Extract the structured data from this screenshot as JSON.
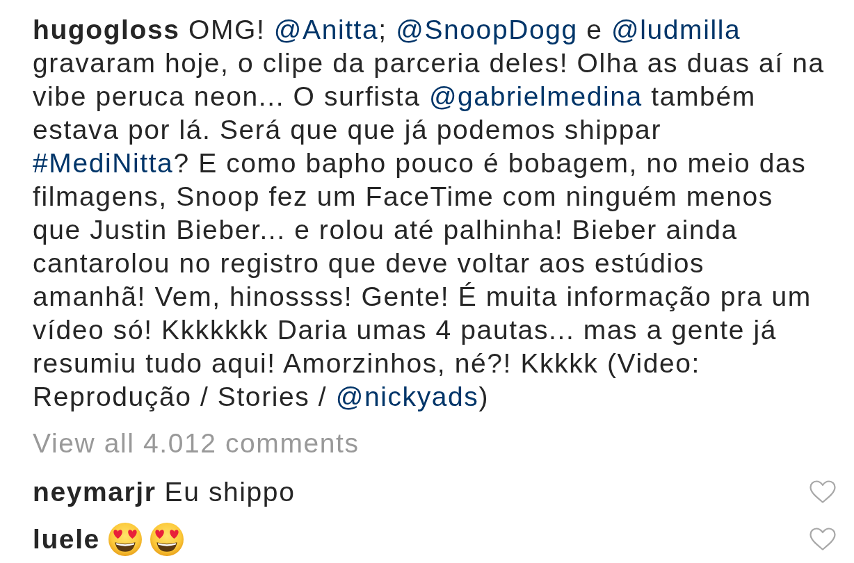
{
  "post": {
    "caption_lines": [
      [
        {
          "kind": "username",
          "text": "hugogloss"
        },
        {
          "kind": "text",
          "text": " OMG! "
        },
        {
          "kind": "mention",
          "text": "@Anitta"
        },
        {
          "kind": "text",
          "text": "; "
        },
        {
          "kind": "mention",
          "text": "@SnoopDogg"
        },
        {
          "kind": "text",
          "text": " e "
        },
        {
          "kind": "mention",
          "text": "@ludmilla"
        }
      ],
      [
        {
          "kind": "text",
          "text": "gravaram hoje, o clipe da parceria deles! Olha as duas aí na"
        }
      ],
      [
        {
          "kind": "text",
          "text": "vibe peruca neon... O surfista "
        },
        {
          "kind": "mention",
          "text": "@gabrielmedina"
        },
        {
          "kind": "text",
          "text": " também"
        }
      ],
      [
        {
          "kind": "text",
          "text": "estava por lá. Será que que já podemos shippar"
        }
      ],
      [
        {
          "kind": "hashtag",
          "text": "#MediNitta"
        },
        {
          "kind": "text",
          "text": "? E como bapho pouco é bobagem, no meio das"
        }
      ],
      [
        {
          "kind": "text",
          "text": "filmagens, Snoop fez um FaceTime com ninguém menos"
        }
      ],
      [
        {
          "kind": "text",
          "text": "que Justin Bieber... e rolou até palhinha! Bieber ainda"
        }
      ],
      [
        {
          "kind": "text",
          "text": "cantarolou no registro que deve voltar aos estúdios"
        }
      ],
      [
        {
          "kind": "text",
          "text": "amanhã! Vem, hinossss! Gente! É muita informação pra um"
        }
      ],
      [
        {
          "kind": "text",
          "text": "vídeo só! Kkkkkkk Daria umas 4 pautas... mas a gente já"
        }
      ],
      [
        {
          "kind": "text",
          "text": "resumiu tudo aqui! Amorzinhos, né?! Kkkkk (Video:"
        }
      ],
      [
        {
          "kind": "text",
          "text": "Reprodução / Stories / "
        },
        {
          "kind": "mention",
          "text": "@nickyads"
        },
        {
          "kind": "text",
          "text": ")"
        }
      ]
    ],
    "view_all_comments": "View all 4.012 comments",
    "comments": [
      {
        "username": "neymarjr",
        "body": [
          {
            "kind": "text",
            "text": "Eu shippo"
          }
        ],
        "liked": false
      },
      {
        "username": "luele",
        "body": [
          {
            "kind": "emoji"
          },
          {
            "kind": "emoji"
          }
        ],
        "liked": false
      }
    ]
  }
}
